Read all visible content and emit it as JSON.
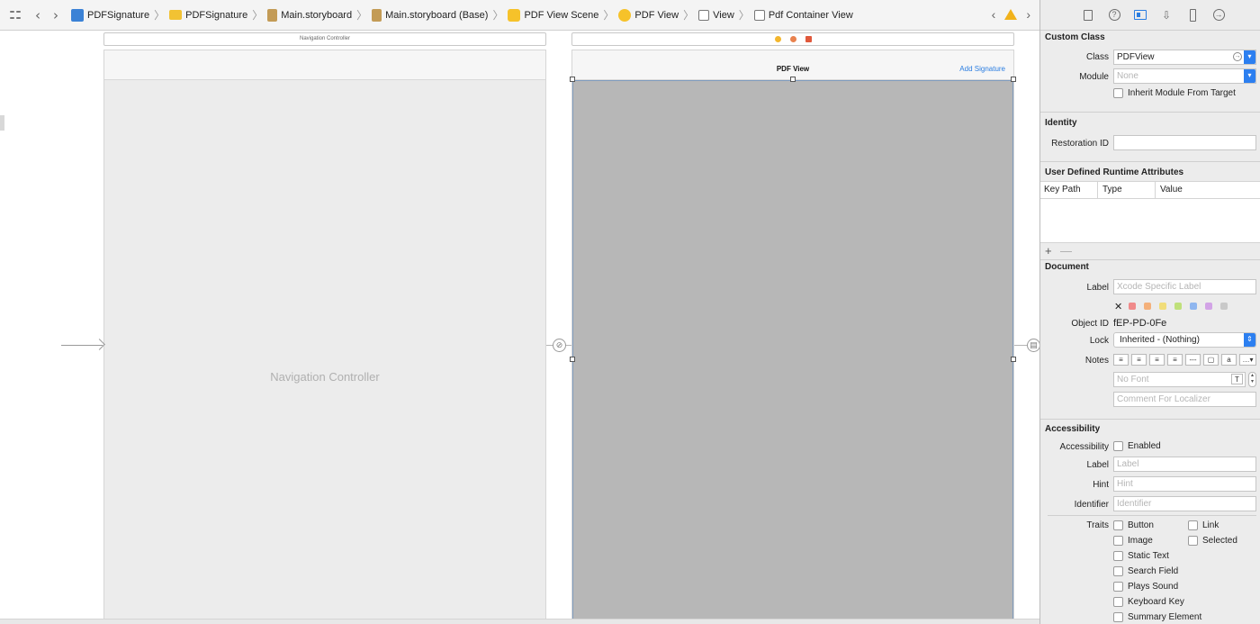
{
  "breadcrumb": {
    "items": [
      {
        "label": "PDFSignature",
        "icon": "project-icon"
      },
      {
        "label": "PDFSignature",
        "icon": "folder-icon"
      },
      {
        "label": "Main.storyboard",
        "icon": "storyboard-icon"
      },
      {
        "label": "Main.storyboard (Base)",
        "icon": "storyboard-icon"
      },
      {
        "label": "PDF View Scene",
        "icon": "scene-icon"
      },
      {
        "label": "PDF View",
        "icon": "view-controller-icon"
      },
      {
        "label": "View",
        "icon": "view-icon"
      },
      {
        "label": "Pdf Container View",
        "icon": "view-icon"
      }
    ],
    "nav_back": "‹",
    "nav_forward": "›",
    "sep": "〉"
  },
  "canvas": {
    "nav_controller_scene_title": "Navigation Controller",
    "nav_controller_label": "Navigation Controller",
    "pdf_scene_title": "PDF View",
    "pdf_nav_action": "Add Signature",
    "scene_dot_colors": [
      "#f3b62d",
      "#e9824e",
      "#e0583b"
    ]
  },
  "inspector": {
    "custom_class": {
      "title": "Custom Class",
      "class_label": "Class",
      "class_value": "PDFView",
      "module_label": "Module",
      "module_placeholder": "None",
      "inherit_label": "Inherit Module From Target"
    },
    "identity": {
      "title": "Identity",
      "restoration_label": "Restoration ID",
      "restoration_value": ""
    },
    "runtime_attributes": {
      "title": "User Defined Runtime Attributes",
      "columns": [
        "Key Path",
        "Type",
        "Value"
      ],
      "add": "+",
      "remove": "—"
    },
    "document": {
      "title": "Document",
      "label_label": "Label",
      "label_placeholder": "Xcode Specific Label",
      "clear_symbol": "✕",
      "swatch_colors": [
        "#f08a8a",
        "#f4b07a",
        "#f1dd7a",
        "#bfe07a",
        "#8fb6ef",
        "#d2a3e6",
        "#c9c9c9"
      ],
      "object_id_label": "Object ID",
      "object_id_value": "fEP-PD-0Fe",
      "lock_label": "Lock",
      "lock_value": "Inherited - (Nothing)",
      "notes_label": "Notes",
      "font_placeholder": "No Font",
      "comment_placeholder": "Comment For Localizer"
    },
    "accessibility": {
      "title": "Accessibility",
      "accessibility_label": "Accessibility",
      "enabled_label": "Enabled",
      "label_label": "Label",
      "label_placeholder": "Label",
      "hint_label": "Hint",
      "hint_placeholder": "Hint",
      "identifier_label": "Identifier",
      "identifier_placeholder": "Identifier",
      "traits_label": "Traits",
      "traits_left": [
        "Button",
        "Image",
        "Static Text",
        "Search Field",
        "Plays Sound",
        "Keyboard Key",
        "Summary Element"
      ],
      "traits_right": [
        "Link",
        "Selected"
      ]
    }
  }
}
